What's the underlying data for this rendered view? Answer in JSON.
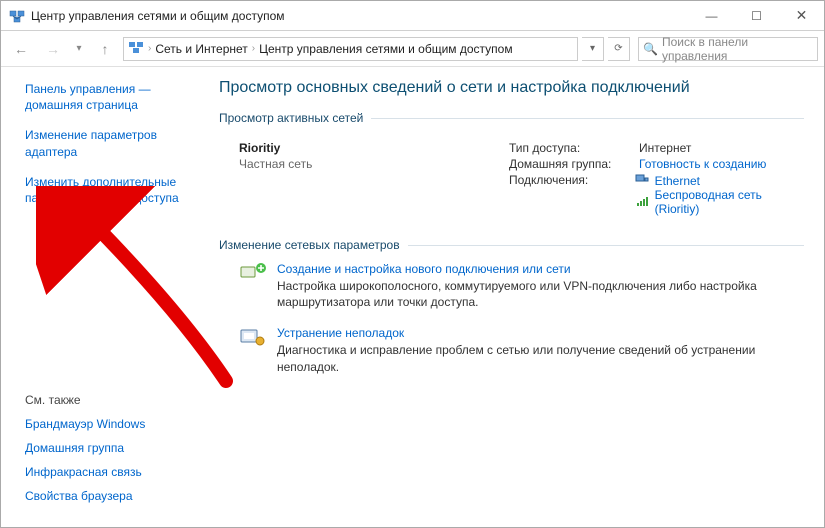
{
  "window": {
    "title": "Центр управления сетями и общим доступом"
  },
  "breadcrumb": {
    "item1": "Сеть и Интернет",
    "item2": "Центр управления сетями и общим доступом"
  },
  "search": {
    "placeholder": "Поиск в панели управления"
  },
  "sidebar": {
    "home": "Панель управления — домашняя страница",
    "items": [
      "Изменение параметров адаптера",
      "Изменить дополнительные параметры общего доступа"
    ],
    "seealso_head": "См. также",
    "seealso": [
      "Брандмауэр Windows",
      "Домашняя группа",
      "Инфракрасная связь",
      "Свойства браузера"
    ]
  },
  "main": {
    "heading": "Просмотр основных сведений о сети и настройка подключений",
    "group_active": "Просмотр активных сетей",
    "network": {
      "name": "Rioritiy",
      "type": "Частная сеть",
      "access_label": "Тип доступа:",
      "access_value": "Интернет",
      "homegroup_label": "Домашняя группа:",
      "homegroup_link": "Готовность к созданию",
      "connections_label": "Подключения:",
      "conn_ethernet": "Ethernet",
      "conn_wifi": "Беспроводная сеть (Rioritiy)"
    },
    "group_change": "Изменение сетевых параметров",
    "action1": {
      "title": "Создание и настройка нового подключения или сети",
      "desc": "Настройка широкополосного, коммутируемого или VPN-подключения либо настройка маршрутизатора или точки доступа."
    },
    "action2": {
      "title": "Устранение неполадок",
      "desc": "Диагностика и исправление проблем с сетью или получение сведений об устранении неполадок."
    }
  }
}
